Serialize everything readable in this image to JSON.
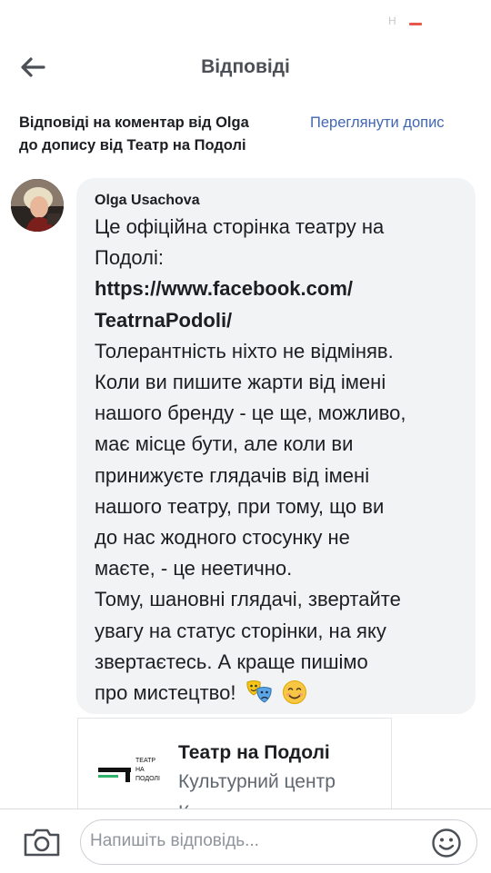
{
  "status_bar": {
    "indicator": "H",
    "accent_color": "#e8584a"
  },
  "header": {
    "title": "Відповіді",
    "back_icon": "arrow-left-icon"
  },
  "context": {
    "description_line1": "Відповіді на коментар від Olga",
    "description_line2": "до допису від Театр на Подолі",
    "view_post_label": "Переглянути допис",
    "link_color": "#4267b2"
  },
  "comment": {
    "author": "Olga Usachova",
    "body_lines": [
      "Це офіційна сторінка театру на",
      "Подолі:"
    ],
    "url_line1": "https://www.facebook.com/",
    "url_line2": "TeatrnaPodoli/",
    "body_lines_2": [
      "Толерантність ніхто не відміняв.",
      "Коли ви пишите жарти від імені",
      "нашого бренду - це ще, можливо,",
      "має місце бути, але коли ви",
      "принижуєте глядачів від імені",
      "нашого театру, при тому, що ви",
      "до нас жодного стосунку не",
      "маєте, - це неетично.",
      "Тому, шановні глядачі, звертайте",
      "увагу на статус сторінки, на яку",
      "звертаєтесь. А краще пишімо"
    ],
    "last_line": "про мистецтво!",
    "emojis": [
      "theater-masks-icon",
      "smiling-face-icon"
    ]
  },
  "page_card": {
    "logo_text": [
      "ТЕАТР",
      "НА",
      "ПОДОЛІ"
    ],
    "name": "Театр на Подолі",
    "category": "Культурний центр",
    "extra": "К"
  },
  "reply_bar": {
    "placeholder": "Напишіть відповідь...",
    "camera_icon": "camera-icon",
    "emoji_icon": "emoji-icon"
  }
}
